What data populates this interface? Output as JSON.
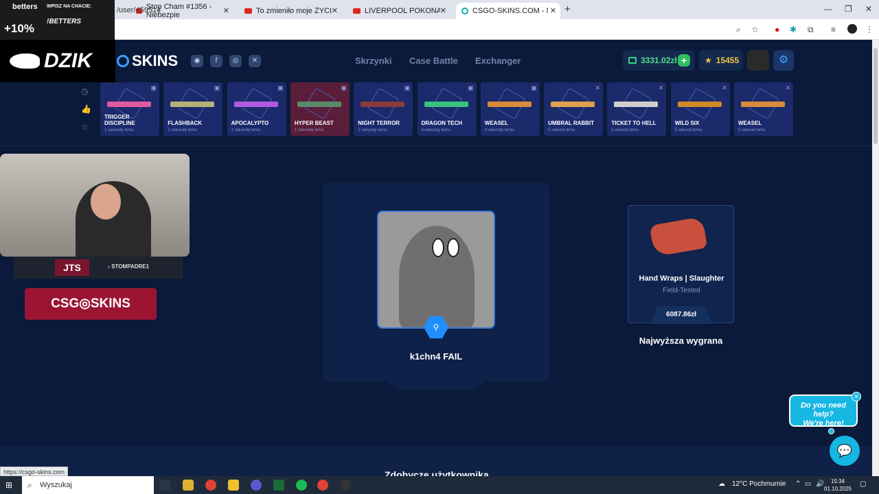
{
  "browser": {
    "tabs": [
      {
        "title": "Stop Cham #1356 - Niebezpie",
        "type": "youtube"
      },
      {
        "title": "To zmieniło moje ŻYCIE | Baba",
        "type": "youtube"
      },
      {
        "title": "LIVERPOOL POKONANY! GIGA",
        "type": "youtube"
      },
      {
        "title": "CSGO-SKINS.COM - Najlepsze",
        "type": "active"
      }
    ],
    "url": "/user/459514",
    "status_url": "https://csgo-skins.com"
  },
  "overlay": {
    "betters_brand": "betters",
    "betters_tag": "WPISZ NA CHACIE:",
    "betters_code": "!BETTERS",
    "betters_bonus": "+10%",
    "dzik": "DZIK",
    "tiktok_handle": "STOMPADRE1",
    "streamer_logo": "JTS",
    "csgo_banner": "CSG◎SKINS"
  },
  "header": {
    "logo": "SKINS",
    "socials": [
      "discord-icon",
      "facebook-icon",
      "instagram-icon",
      "x-icon"
    ],
    "nav": [
      "Skrzynki",
      "Case Battle",
      "Exchanger"
    ],
    "balance": "3331.02zł",
    "points": "15455"
  },
  "drops": [
    {
      "name": "TRIGGER DISCIPLINE",
      "time": "1 sekundę temu",
      "color": "#e05aa0",
      "red": false
    },
    {
      "name": "FLASHBACK",
      "time": "1 sekundę temu",
      "color": "#b7b07a",
      "red": false
    },
    {
      "name": "APOCALYPTO",
      "time": "1 sekundę temu",
      "color": "#b05ae0",
      "red": false
    },
    {
      "name": "HYPER BEAST",
      "time": "1 sekundę temu",
      "color": "#5a8a6a",
      "red": true
    },
    {
      "name": "NIGHT TERROR",
      "time": "2 sekundy temu",
      "color": "#8a3a3a",
      "red": false
    },
    {
      "name": "DRAGON TECH",
      "time": "4 sekundy temu",
      "color": "#3ac080",
      "red": false
    },
    {
      "name": "WEASEL",
      "time": "4 sekundy temu",
      "color": "#d98a3a",
      "red": false
    },
    {
      "name": "UMBRAL RABBIT",
      "time": "5 sekund temu",
      "color": "#e0a050",
      "red": false
    },
    {
      "name": "TICKET TO HELL",
      "time": "5 sekund temu",
      "color": "#cfcfcf",
      "red": false
    },
    {
      "name": "WILD SIX",
      "time": "5 sekund temu",
      "color": "#d08a2a",
      "red": false
    },
    {
      "name": "WEASEL",
      "time": "5 sekund temu",
      "color": "#d98a3a",
      "red": false
    }
  ],
  "profile": {
    "username": "k1chn4 FAIL"
  },
  "best_drop": {
    "name": "Hand Wraps | Slaughter",
    "wear": "Field-Tested",
    "price": "6087.86zł",
    "label": "Najwyższa wygrana"
  },
  "section": {
    "title": "Zdobycze użytkownika"
  },
  "chat": {
    "help_line1": "Do you need help?",
    "help_line2": "We're here!"
  },
  "taskbar": {
    "search": "Wyszukaj",
    "weather": "12°C  Pochmurnie",
    "time": "15:34",
    "date": "01.10.2025"
  }
}
